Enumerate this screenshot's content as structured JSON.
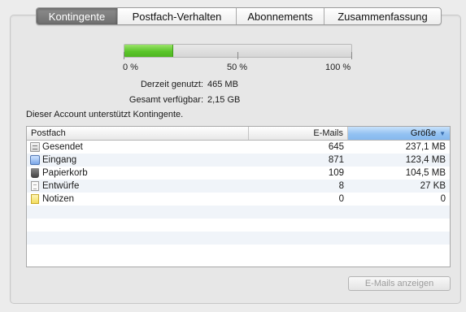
{
  "tabs": [
    {
      "label": "Kontingente",
      "active": true
    },
    {
      "label": "Postfach-Verhalten",
      "active": false
    },
    {
      "label": "Abonnements",
      "active": false
    },
    {
      "label": "Zusammenfassung",
      "active": false
    }
  ],
  "quota": {
    "used_fraction": 0.215,
    "tick_labels": [
      "0 %",
      "50 %",
      "100 %"
    ],
    "fill_color": "#5bc52b"
  },
  "info": {
    "used_label": "Derzeit genutzt:",
    "used_value": "465 MB",
    "total_label": "Gesamt verfügbar:",
    "total_value": "2,15 GB"
  },
  "note": "Dieser Account unterstützt Kontingente.",
  "table": {
    "headers": {
      "mailbox": "Postfach",
      "mails": "E-Mails",
      "size": "Größe"
    },
    "sort_column": "size",
    "rows": [
      {
        "icon": "sent-icon",
        "name": "Gesendet",
        "mails": "645",
        "size": "237,1 MB"
      },
      {
        "icon": "inbox-icon",
        "name": "Eingang",
        "mails": "871",
        "size": "123,4 MB"
      },
      {
        "icon": "trash-icon",
        "name": "Papierkorb",
        "mails": "109",
        "size": "104,5 MB"
      },
      {
        "icon": "drafts-icon",
        "name": "Entwürfe",
        "mails": "8",
        "size": "27 KB"
      },
      {
        "icon": "notes-icon",
        "name": "Notizen",
        "mails": "0",
        "size": "0"
      }
    ]
  },
  "button": {
    "label": "E-Mails anzeigen",
    "enabled": false
  }
}
